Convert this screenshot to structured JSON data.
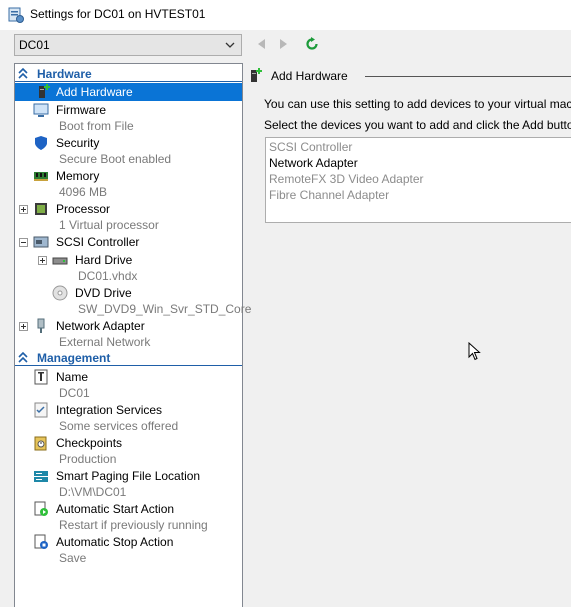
{
  "window": {
    "title": "Settings for DC01 on HVTEST01"
  },
  "vm_selector": {
    "value": "DC01"
  },
  "sidebar": {
    "hardware_header": "Hardware",
    "management_header": "Management",
    "hardware_items": [
      {
        "label": "Add Hardware",
        "sub": ""
      },
      {
        "label": "Firmware",
        "sub": "Boot from File"
      },
      {
        "label": "Security",
        "sub": "Secure Boot enabled"
      },
      {
        "label": "Memory",
        "sub": "4096 MB"
      },
      {
        "label": "Processor",
        "sub": "1 Virtual processor"
      },
      {
        "label": "SCSI Controller",
        "sub": ""
      },
      {
        "label": "Hard Drive",
        "sub": "DC01.vhdx"
      },
      {
        "label": "DVD Drive",
        "sub": "SW_DVD9_Win_Svr_STD_Core..."
      },
      {
        "label": "Network Adapter",
        "sub": "External Network"
      }
    ],
    "management_items": [
      {
        "label": "Name",
        "sub": "DC01"
      },
      {
        "label": "Integration Services",
        "sub": "Some services offered"
      },
      {
        "label": "Checkpoints",
        "sub": "Production"
      },
      {
        "label": "Smart Paging File Location",
        "sub": "D:\\VM\\DC01"
      },
      {
        "label": "Automatic Start Action",
        "sub": "Restart if previously running"
      },
      {
        "label": "Automatic Stop Action",
        "sub": "Save"
      }
    ]
  },
  "main": {
    "group_title": "Add Hardware",
    "description_1": "You can use this setting to add devices to your virtual machine.",
    "description_2": "Select the devices you want to add and click the Add button.",
    "devices": [
      {
        "label": "SCSI Controller",
        "enabled": false
      },
      {
        "label": "Network Adapter",
        "enabled": true
      },
      {
        "label": "RemoteFX 3D Video Adapter",
        "enabled": false
      },
      {
        "label": "Fibre Channel Adapter",
        "enabled": false
      }
    ]
  },
  "colors": {
    "accent": "#1f5fa8",
    "selection": "#0a74d6",
    "refresh_green": "#1c9b3a"
  }
}
